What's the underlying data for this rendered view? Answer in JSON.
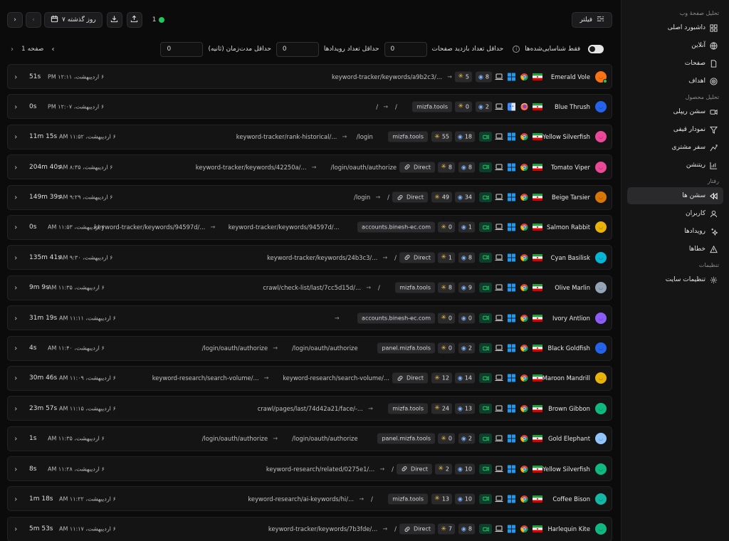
{
  "sidebar": {
    "groups": [
      {
        "title": "تحلیل صفحهٔ وب",
        "items": [
          {
            "label": "داشبورد اصلی",
            "icon": "dashboard-icon"
          },
          {
            "label": "آنلاین",
            "icon": "globe-icon"
          },
          {
            "label": "صفحات",
            "icon": "page-icon"
          },
          {
            "label": "اهداف",
            "icon": "target-icon"
          }
        ]
      },
      {
        "title": "تحلیل محصول",
        "items": [
          {
            "label": "سشن ریپلی",
            "icon": "video-icon"
          },
          {
            "label": "نمودار قیفی",
            "icon": "funnel-icon"
          },
          {
            "label": "سفر مشتری",
            "icon": "path-icon"
          },
          {
            "label": "ریتنشن",
            "icon": "retention-chart-icon"
          }
        ]
      },
      {
        "title": "رفتار",
        "items": [
          {
            "label": "سشن ها",
            "icon": "rewind-icon",
            "active": true
          },
          {
            "label": "کاربران",
            "icon": "user-icon"
          },
          {
            "label": "رویدادها",
            "icon": "sparkle-icon"
          },
          {
            "label": "خطاها",
            "icon": "warning-icon"
          }
        ]
      },
      {
        "title": "تنظیمات",
        "items": [
          {
            "label": "تنظیمات سایت",
            "icon": "gear-icon"
          }
        ]
      }
    ]
  },
  "toolbar": {
    "date_range": "۷ روز گذشته",
    "online_count": "1",
    "filter_label": "فیلتر"
  },
  "filters": {
    "page_label": "صفحه 1",
    "duration_label": "حداقل مدت‌زمان (ثانیه)",
    "duration_value": "0",
    "events_label": "حداقل تعداد رویدادها",
    "events_value": "0",
    "pageviews_label": "حداقل تعداد بازدید صفحات",
    "pageviews_value": "0",
    "identified_label": "فقط شناسایی‌شده‌ها"
  },
  "colors": {
    "accent_green": "#22c55e",
    "event_icon": "#f5c542",
    "view_icon": "#7fb2ff"
  },
  "sessions": [
    {
      "name": "Emerald Vole",
      "avatar_color": "#f97316",
      "online": true,
      "browser": "chrome",
      "views": "8",
      "events": "5",
      "recording": false,
      "source": "",
      "entry": "",
      "exit": "keyword-tracker/keywords/a9b2c3/...",
      "time": "۶ اردیبهشت، ۱۲:۱۱ PM",
      "duration": "51s"
    },
    {
      "name": "Blue Thrush",
      "avatar_color": "#2563eb",
      "online": false,
      "browser": "firefox",
      "os": "mac",
      "views": "2",
      "events": "0",
      "recording": false,
      "source": "mizfa.tools",
      "entry": "/",
      "exit": "/",
      "time": "۶ اردیبهشت، ۱۲:۰۷ PM",
      "duration": "0s"
    },
    {
      "name": "Yellow Silverfish",
      "avatar_color": "#ec4899",
      "online": false,
      "browser": "chrome",
      "views": "18",
      "events": "55",
      "recording": true,
      "source": "mizfa.tools",
      "entry": "/login",
      "exit": "keyword-tracker/rank-historical/...",
      "time": "۶ اردیبهشت، ۱۱:۵۲ AM",
      "duration": "11m 15s"
    },
    {
      "name": "Tomato Viper",
      "avatar_color": "#ec4899",
      "online": false,
      "browser": "chrome",
      "views": "8",
      "events": "8",
      "recording": true,
      "source": "Direct",
      "entry": "/login/oauth/authorize",
      "exit": "keyword-tracker/keywords/42250a/...",
      "time": "۶ اردیبهشت، ۸:۳۵ AM",
      "duration": "204m 40s"
    },
    {
      "name": "Beige Tarsier",
      "avatar_color": "#d97706",
      "online": false,
      "browser": "chrome",
      "views": "34",
      "events": "49",
      "recording": true,
      "source": "Direct",
      "entry": "/",
      "exit": "/login",
      "time": "۶ اردیبهشت، ۹:۲۹ AM",
      "duration": "149m 39s"
    },
    {
      "name": "Salmon Rabbit",
      "avatar_color": "#eab308",
      "online": false,
      "browser": "chrome",
      "views": "1",
      "events": "0",
      "recording": true,
      "source": "accounts.binesh-ec.com",
      "entry": "keyword-tracker/keywords/94597d/...",
      "exit": "keyword-tracker/keywords/94597d/...",
      "time": "۶ اردیبهشت، ۱۱:۵۳ AM",
      "duration": "0s"
    },
    {
      "name": "Cyan Basilisk",
      "avatar_color": "#06b6d4",
      "online": false,
      "browser": "chrome",
      "views": "8",
      "events": "1",
      "recording": true,
      "source": "Direct",
      "entry": "/",
      "exit": "keyword-tracker/keywords/24b3c3/...",
      "time": "۶ اردیبهشت، ۹:۳۰ AM",
      "duration": "135m 41s"
    },
    {
      "name": "Olive Marlin",
      "avatar_color": "#94a3b8",
      "online": false,
      "browser": "chrome",
      "views": "9",
      "events": "8",
      "recording": true,
      "source": "mizfa.tools",
      "entry": "/",
      "exit": "crawl/check-list/last/7cc5d15d/...",
      "time": "۶ اردیبهشت، ۱۱:۳۵ AM",
      "duration": "9m 9s"
    },
    {
      "name": "Ivory Antlion",
      "avatar_color": "#8b5cf6",
      "online": false,
      "browser": "chrome",
      "views": "0",
      "events": "0",
      "recording": true,
      "source": "accounts.binesh-ec.com",
      "entry": "",
      "exit": "",
      "time": "۶ اردیبهشت، ۱۱:۱۱ AM",
      "duration": "31m 19s"
    },
    {
      "name": "Black Goldfish",
      "avatar_color": "#2563eb",
      "online": false,
      "browser": "chrome",
      "views": "2",
      "events": "0",
      "recording": true,
      "source": "panel.mizfa.tools",
      "entry": "/login/oauth/authorize",
      "exit": "/login/oauth/authorize",
      "time": "۶ اردیبهشت، ۱۱:۴۰ AM",
      "duration": "4s"
    },
    {
      "name": "Maroon Mandrill",
      "avatar_color": "#eab308",
      "online": false,
      "browser": "chrome",
      "views": "14",
      "events": "12",
      "recording": true,
      "source": "Direct",
      "entry": "keyword-research/search-volume/...",
      "exit": "keyword-research/search-volume/...",
      "time": "۶ اردیبهشت، ۱۱:۰۹ AM",
      "duration": "30m 46s"
    },
    {
      "name": "Brown Gibbon",
      "avatar_color": "#10b981",
      "online": false,
      "browser": "chrome",
      "views": "13",
      "events": "24",
      "recording": true,
      "source": "mizfa.tools",
      "entry": "",
      "exit": "crawl/pages/last/74d42a21/face/-...",
      "time": "۶ اردیبهشت، ۱۱:۱۵ AM",
      "duration": "23m 57s"
    },
    {
      "name": "Gold Elephant",
      "avatar_color": "#93c5fd",
      "online": false,
      "browser": "chrome",
      "views": "2",
      "events": "0",
      "recording": true,
      "source": "panel.mizfa.tools",
      "entry": "/login/oauth/authorize",
      "exit": "/login/oauth/authorize",
      "time": "۶ اردیبهشت، ۱۱:۳۵ AM",
      "duration": "1s"
    },
    {
      "name": "Yellow Silverfish",
      "avatar_color": "#10b981",
      "online": false,
      "browser": "chrome",
      "views": "10",
      "events": "2",
      "recording": true,
      "source": "Direct",
      "entry": "/",
      "exit": "keyword-research/related/0275e1/...",
      "time": "۶ اردیبهشت، ۱۱:۲۸ AM",
      "duration": "8s"
    },
    {
      "name": "Coffee Bison",
      "avatar_color": "#14b8a6",
      "online": false,
      "browser": "chrome",
      "views": "10",
      "events": "13",
      "recording": true,
      "source": "mizfa.tools",
      "entry": "/",
      "exit": "keyword-research/ai-keywords/hi/...",
      "time": "۶ اردیبهشت، ۱۱:۲۲ AM",
      "duration": "1m 18s"
    },
    {
      "name": "Harlequin Kite",
      "avatar_color": "#10b981",
      "online": false,
      "browser": "chrome",
      "views": "8",
      "events": "7",
      "recording": true,
      "source": "Direct",
      "entry": "/",
      "exit": "keyword-tracker/keywords/7b3fde/...",
      "time": "۶ اردیبهشت، ۱۱:۱۷ AM",
      "duration": "5m 53s"
    }
  ]
}
